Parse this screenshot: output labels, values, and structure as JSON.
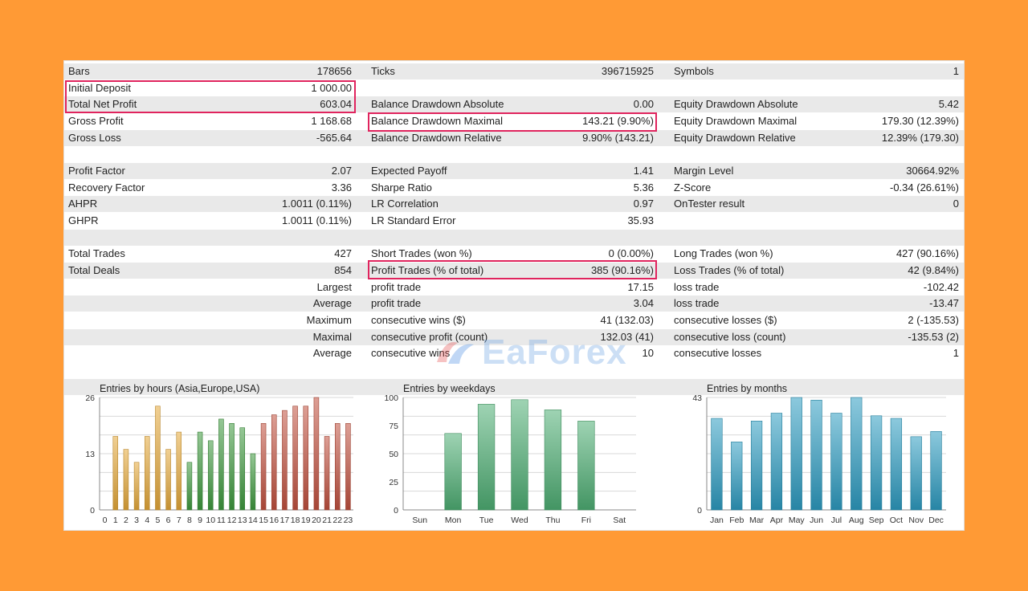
{
  "stats": {
    "rows": [
      {
        "shade": true,
        "c1": [
          "Bars",
          "178656"
        ],
        "c2": [
          "Ticks",
          "396715925"
        ],
        "c3": [
          "Symbols",
          "1"
        ]
      },
      {
        "shade": false,
        "c1": [
          "Initial Deposit",
          "1 000.00"
        ],
        "c2": [
          "",
          ""
        ],
        "c3": [
          "",
          ""
        ]
      },
      {
        "shade": true,
        "c1": [
          "Total Net Profit",
          "603.04"
        ],
        "c2": [
          "Balance Drawdown Absolute",
          "0.00"
        ],
        "c3": [
          "Equity Drawdown Absolute",
          "5.42"
        ]
      },
      {
        "shade": false,
        "c1": [
          "Gross Profit",
          "1 168.68"
        ],
        "c2": [
          "Balance Drawdown Maximal",
          "143.21 (9.90%)"
        ],
        "c3": [
          "Equity Drawdown Maximal",
          "179.30 (12.39%)"
        ]
      },
      {
        "shade": true,
        "c1": [
          "Gross Loss",
          "-565.64"
        ],
        "c2": [
          "Balance Drawdown Relative",
          "9.90% (143.21)"
        ],
        "c3": [
          "Equity Drawdown Relative",
          "12.39% (179.30)"
        ]
      },
      {
        "shade": false,
        "c1": [
          "",
          ""
        ],
        "c2": [
          "",
          ""
        ],
        "c3": [
          "",
          ""
        ]
      },
      {
        "shade": true,
        "c1": [
          "Profit Factor",
          "2.07"
        ],
        "c2": [
          "Expected Payoff",
          "1.41"
        ],
        "c3": [
          "Margin Level",
          "30664.92%"
        ]
      },
      {
        "shade": false,
        "c1": [
          "Recovery Factor",
          "3.36"
        ],
        "c2": [
          "Sharpe Ratio",
          "5.36"
        ],
        "c3": [
          "Z-Score",
          "-0.34 (26.61%)"
        ]
      },
      {
        "shade": true,
        "c1": [
          "AHPR",
          "1.0011 (0.11%)"
        ],
        "c2": [
          "LR Correlation",
          "0.97"
        ],
        "c3": [
          "OnTester result",
          "0"
        ]
      },
      {
        "shade": false,
        "c1": [
          "GHPR",
          "1.0011 (0.11%)"
        ],
        "c2": [
          "LR Standard Error",
          "35.93"
        ],
        "c3": [
          "",
          ""
        ]
      },
      {
        "shade": true,
        "c1": [
          "",
          ""
        ],
        "c2": [
          "",
          ""
        ],
        "c3": [
          "",
          ""
        ]
      },
      {
        "shade": false,
        "c1": [
          "Total Trades",
          "427"
        ],
        "c2": [
          "Short Trades (won %)",
          "0 (0.00%)"
        ],
        "c3": [
          "Long Trades (won %)",
          "427 (90.16%)"
        ]
      },
      {
        "shade": true,
        "c1": [
          "Total Deals",
          "854"
        ],
        "c2": [
          "Profit Trades (% of total)",
          "385 (90.16%)"
        ],
        "c3": [
          "Loss Trades (% of total)",
          "42 (9.84%)"
        ]
      },
      {
        "shade": false,
        "c1": [
          "",
          "Largest"
        ],
        "c2": [
          "profit trade",
          "17.15"
        ],
        "c3": [
          "loss trade",
          "-102.42"
        ]
      },
      {
        "shade": true,
        "c1": [
          "",
          "Average"
        ],
        "c2": [
          "profit trade",
          "3.04"
        ],
        "c3": [
          "loss trade",
          "-13.47"
        ]
      },
      {
        "shade": false,
        "c1": [
          "",
          "Maximum"
        ],
        "c2": [
          "consecutive wins ($)",
          "41 (132.03)"
        ],
        "c3": [
          "consecutive losses ($)",
          "2 (-135.53)"
        ]
      },
      {
        "shade": true,
        "c1": [
          "",
          "Maximal"
        ],
        "c2": [
          "consecutive profit (count)",
          "132.03 (41)"
        ],
        "c3": [
          "consecutive loss (count)",
          "-135.53 (2)"
        ]
      },
      {
        "shade": false,
        "c1": [
          "",
          "Average"
        ],
        "c2": [
          "consecutive wins",
          "10"
        ],
        "c3": [
          "consecutive losses",
          "1"
        ]
      },
      {
        "shade": false,
        "c1": [
          "",
          ""
        ],
        "c2": [
          "",
          ""
        ],
        "c3": [
          "",
          ""
        ]
      },
      {
        "shade": true,
        "c1": [
          "",
          ""
        ],
        "c2": [
          "",
          ""
        ],
        "c3": [
          "",
          ""
        ]
      }
    ],
    "highlight_color": "#E0245E"
  },
  "watermark": {
    "text": "EaForex"
  },
  "chart_data": [
    {
      "type": "bar",
      "title": "Entries by hours (Asia,Europe,USA)",
      "categories": [
        "0",
        "1",
        "2",
        "3",
        "4",
        "5",
        "6",
        "7",
        "8",
        "9",
        "10",
        "11",
        "12",
        "13",
        "14",
        "15",
        "16",
        "17",
        "18",
        "19",
        "20",
        "21",
        "22",
        "23"
      ],
      "values": [
        0,
        17,
        14,
        11,
        17,
        24,
        14,
        18,
        11,
        18,
        16,
        21,
        20,
        19,
        13,
        20,
        22,
        23,
        24,
        24,
        26,
        17,
        20,
        20
      ],
      "yticks": [
        "0",
        "13",
        "26"
      ],
      "ylim": [
        0,
        26
      ],
      "colors": [
        "#E6A93A",
        "#E6A93A",
        "#E6A93A",
        "#E6A93A",
        "#E6A93A",
        "#E6A93A",
        "#E6A93A",
        "#E6A93A",
        "#3E9A3E",
        "#3E9A3E",
        "#3E9A3E",
        "#3E9A3E",
        "#3E9A3E",
        "#3E9A3E",
        "#3E9A3E",
        "#C2513F",
        "#C2513F",
        "#C2513F",
        "#C2513F",
        "#C2513F",
        "#C2513F",
        "#C2513F",
        "#C2513F",
        "#C2513F"
      ]
    },
    {
      "type": "bar",
      "title": "Entries by weekdays",
      "categories": [
        "Sun",
        "Mon",
        "Tue",
        "Wed",
        "Thu",
        "Fri",
        "Sat"
      ],
      "values": [
        0,
        68,
        94,
        98,
        89,
        79,
        0
      ],
      "yticks": [
        "0",
        "25",
        "50",
        "75",
        "100"
      ],
      "ylim": [
        0,
        100
      ],
      "colors": [
        "#4FAF74",
        "#4FAF74",
        "#4FAF74",
        "#4FAF74",
        "#4FAF74",
        "#4FAF74",
        "#4FAF74"
      ]
    },
    {
      "type": "bar",
      "title": "Entries by months",
      "categories": [
        "Jan",
        "Feb",
        "Mar",
        "Apr",
        "May",
        "Jun",
        "Jul",
        "Aug",
        "Sep",
        "Oct",
        "Nov",
        "Dec"
      ],
      "values": [
        35,
        26,
        34,
        37,
        43,
        42,
        37,
        43,
        36,
        35,
        28,
        30
      ],
      "yticks": [
        "0",
        "43"
      ],
      "ylim": [
        0,
        43
      ],
      "colors": [
        "#2E9DC2",
        "#2E9DC2",
        "#2E9DC2",
        "#2E9DC2",
        "#2E9DC2",
        "#2E9DC2",
        "#2E9DC2",
        "#2E9DC2",
        "#2E9DC2",
        "#2E9DC2",
        "#2E9DC2",
        "#2E9DC2"
      ]
    }
  ]
}
